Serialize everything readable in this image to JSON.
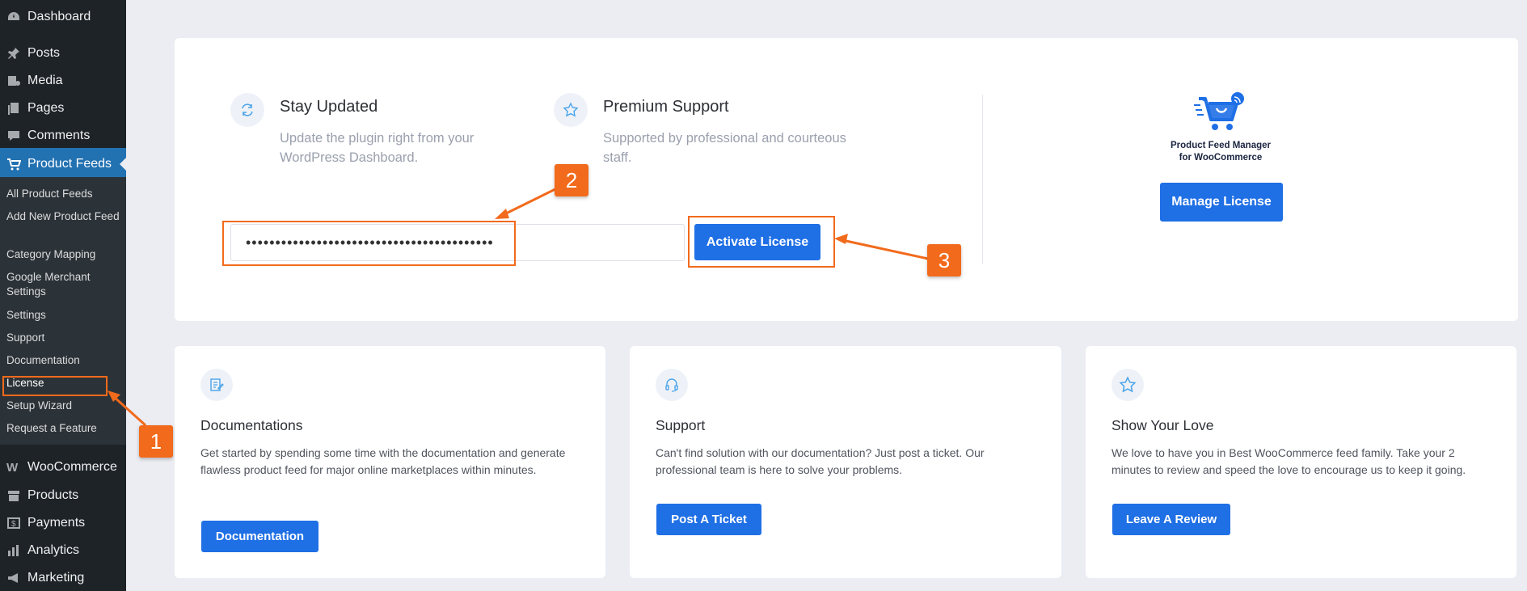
{
  "sidebar": {
    "top_items": [
      {
        "label": "Dashboard",
        "icon": "dashboard-icon"
      },
      {
        "label": "Posts",
        "icon": "pin-icon"
      },
      {
        "label": "Media",
        "icon": "media-icon"
      },
      {
        "label": "Pages",
        "icon": "pages-icon"
      },
      {
        "label": "Comments",
        "icon": "comment-icon"
      }
    ],
    "active": {
      "label": "Product Feeds",
      "icon": "cart-icon"
    },
    "submenu": [
      "All Product Feeds",
      "Add New Product Feed",
      "Category Mapping",
      "Google Merchant Settings",
      "Settings",
      "Support",
      "Documentation",
      "License",
      "Setup Wizard",
      "Request a Feature"
    ],
    "bottom_items": [
      {
        "label": "WooCommerce",
        "icon": "woo-icon"
      },
      {
        "label": "Products",
        "icon": "archive-icon"
      },
      {
        "label": "Payments",
        "icon": "dollar-icon"
      },
      {
        "label": "Analytics",
        "icon": "bar-chart-icon"
      },
      {
        "label": "Marketing",
        "icon": "megaphone-icon"
      }
    ]
  },
  "license_card": {
    "features": [
      {
        "title": "Stay Updated",
        "desc": "Update the plugin right from your WordPress Dashboard.",
        "icon": "refresh-icon"
      },
      {
        "title": "Premium Support",
        "desc": "Supported by professional and courteous staff.",
        "icon": "star-icon"
      }
    ],
    "license_key_value": "••••••••••••••••••••••••••••••••••••••••••",
    "activate_label": "Activate License",
    "logo_text_line1": "Product Feed Manager",
    "logo_text_line2": "for WooCommerce",
    "manage_label": "Manage License"
  },
  "annotations": {
    "badge1": "1",
    "badge2": "2",
    "badge3": "3"
  },
  "bottom_cards": [
    {
      "title": "Documentations",
      "desc": "Get started by spending some time with the documentation and generate flawless product feed for major online marketplaces within minutes.",
      "button": "Documentation",
      "icon": "edit-doc-icon"
    },
    {
      "title": "Support",
      "desc": "Can't find solution with our documentation? Just post a ticket. Our professional team is here to solve your problems.",
      "button": "Post A Ticket",
      "icon": "headset-icon"
    },
    {
      "title": "Show Your Love",
      "desc": "We love to have you in Best WooCommerce feed family. Take your 2 minutes to review and speed the love to encourage us to keep it going.",
      "button": "Leave A Review",
      "icon": "star-icon"
    }
  ],
  "colors": {
    "accent": "#1f6fe5",
    "highlight": "#f26a1b",
    "sidebar_bg": "#1d2327",
    "active_bg": "#2271b1"
  }
}
